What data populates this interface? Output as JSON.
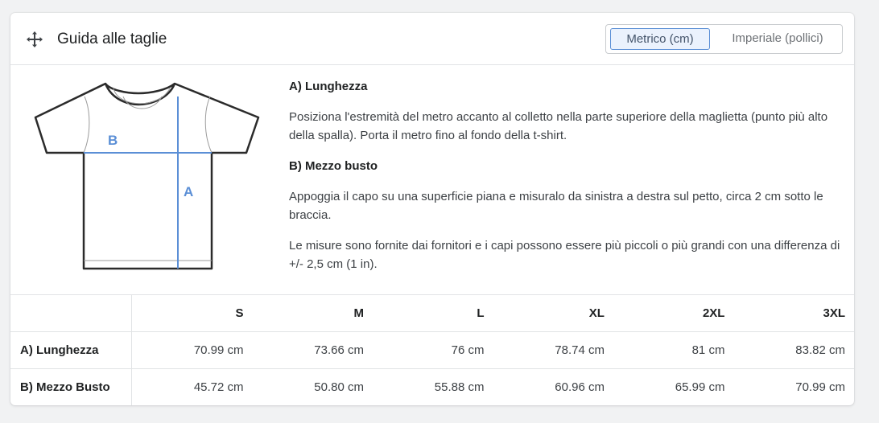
{
  "header": {
    "title": "Guida alle taglie",
    "icon": "move-icon"
  },
  "units": {
    "metric": "Metrico (cm)",
    "imperial": "Imperiale (pollici)",
    "selected": "metric"
  },
  "diagram": {
    "label_a": "A",
    "label_b": "B",
    "accent": "#5b8fd6"
  },
  "description": {
    "a_title": "A) Lunghezza",
    "a_text": "Posiziona l'estremità del metro accanto al colletto nella parte superiore della maglietta (punto più alto della spalla). Porta il metro fino al fondo della t-shirt.",
    "b_title": "B) Mezzo busto",
    "b_text": "Appoggia il capo su una superficie piana e misuralo da sinistra a destra sul petto, circa 2 cm sotto le braccia.",
    "note": "Le misure sono fornite dai fornitori e i capi possono essere più piccoli o più grandi con una differenza di +/- 2,5 cm (1 in)."
  },
  "table": {
    "sizes": [
      "S",
      "M",
      "L",
      "XL",
      "2XL",
      "3XL"
    ],
    "rows": [
      {
        "label": "A) Lunghezza",
        "values": [
          "70.99 cm",
          "73.66 cm",
          "76 cm",
          "78.74 cm",
          "81 cm",
          "83.82 cm"
        ]
      },
      {
        "label": "B) Mezzo Busto",
        "values": [
          "45.72 cm",
          "50.80 cm",
          "55.88 cm",
          "60.96 cm",
          "65.99 cm",
          "70.99 cm"
        ]
      }
    ]
  }
}
